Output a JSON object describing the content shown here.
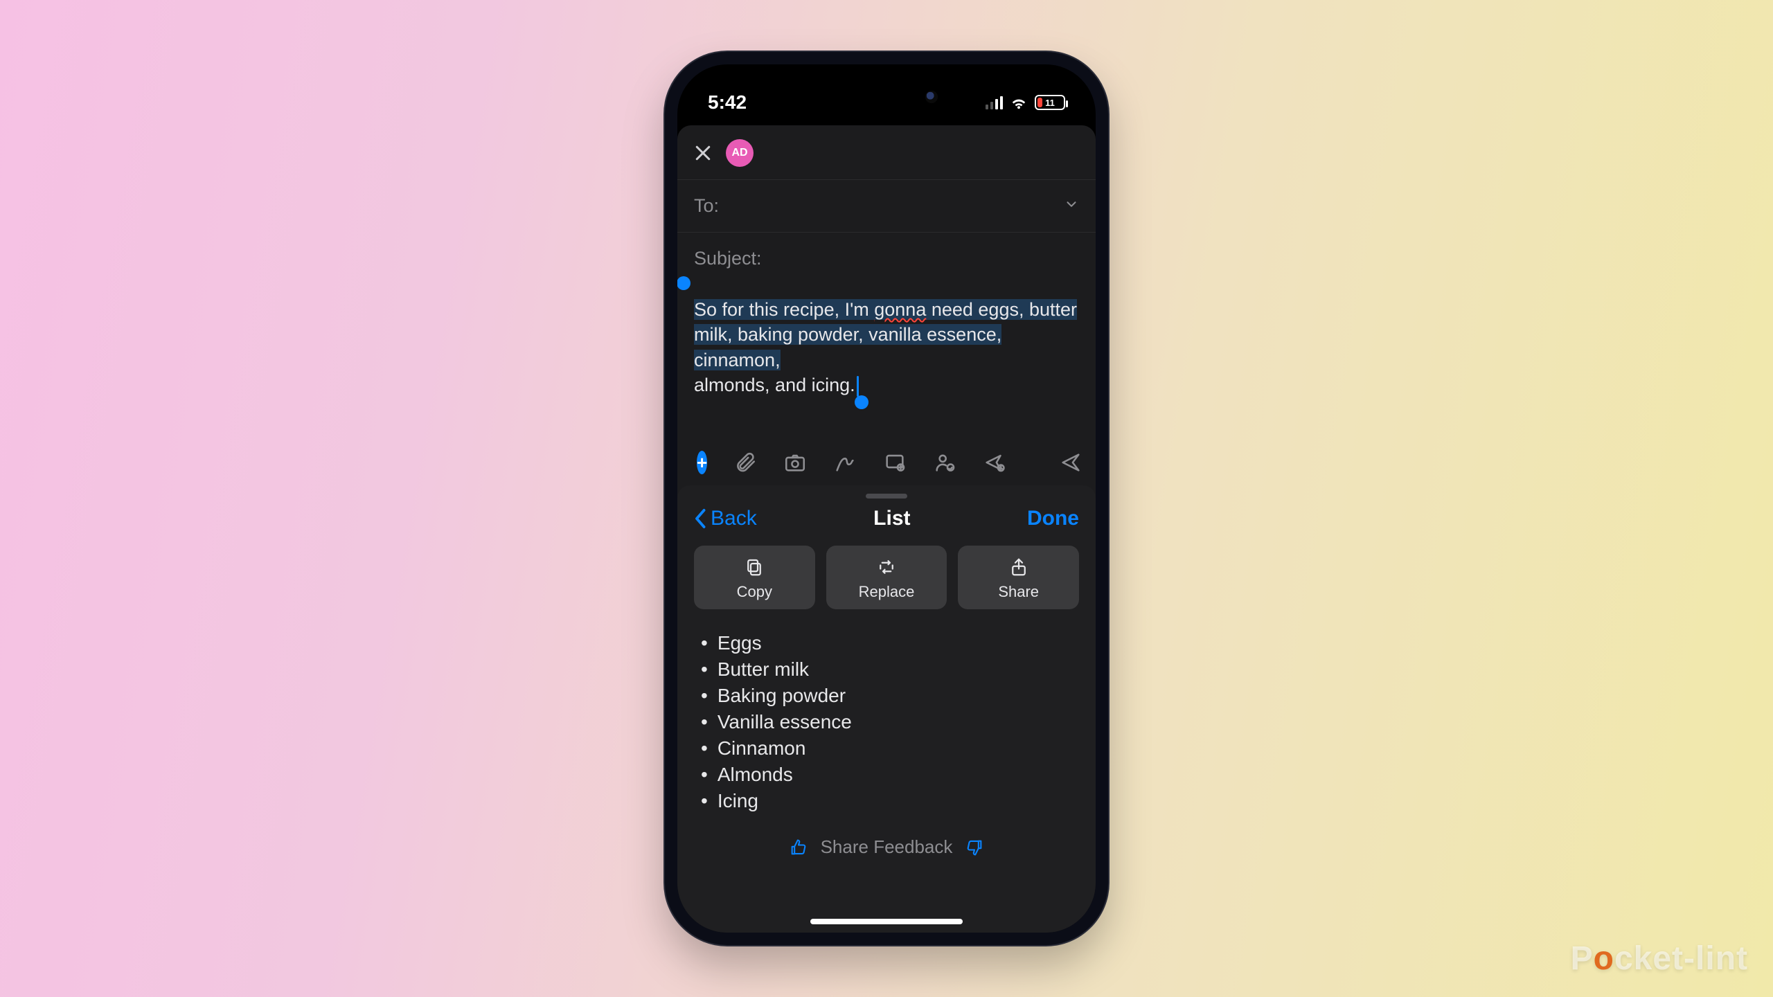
{
  "status": {
    "time": "5:42",
    "battery_pct": "11"
  },
  "compose": {
    "avatar_initials": "AD",
    "to_label": "To:",
    "subject_label": "Subject:",
    "body_pre": "So for this recipe, I'm ",
    "body_squiggle": "gonna",
    "body_post1": " need eggs, butter milk, baking powder, vanilla essence, cinnamon,",
    "body_line3": "almonds, and icing."
  },
  "panel": {
    "back_label": "Back",
    "title": "List",
    "done_label": "Done",
    "actions": {
      "copy": "Copy",
      "replace": "Replace",
      "share": "Share"
    },
    "items": [
      "Eggs",
      "Butter milk",
      "Baking powder",
      "Vanilla essence",
      "Cinnamon",
      "Almonds",
      "Icing"
    ],
    "feedback_label": "Share Feedback"
  },
  "watermark": {
    "pre": "P",
    "o": "o",
    "post": "cket-lint"
  }
}
